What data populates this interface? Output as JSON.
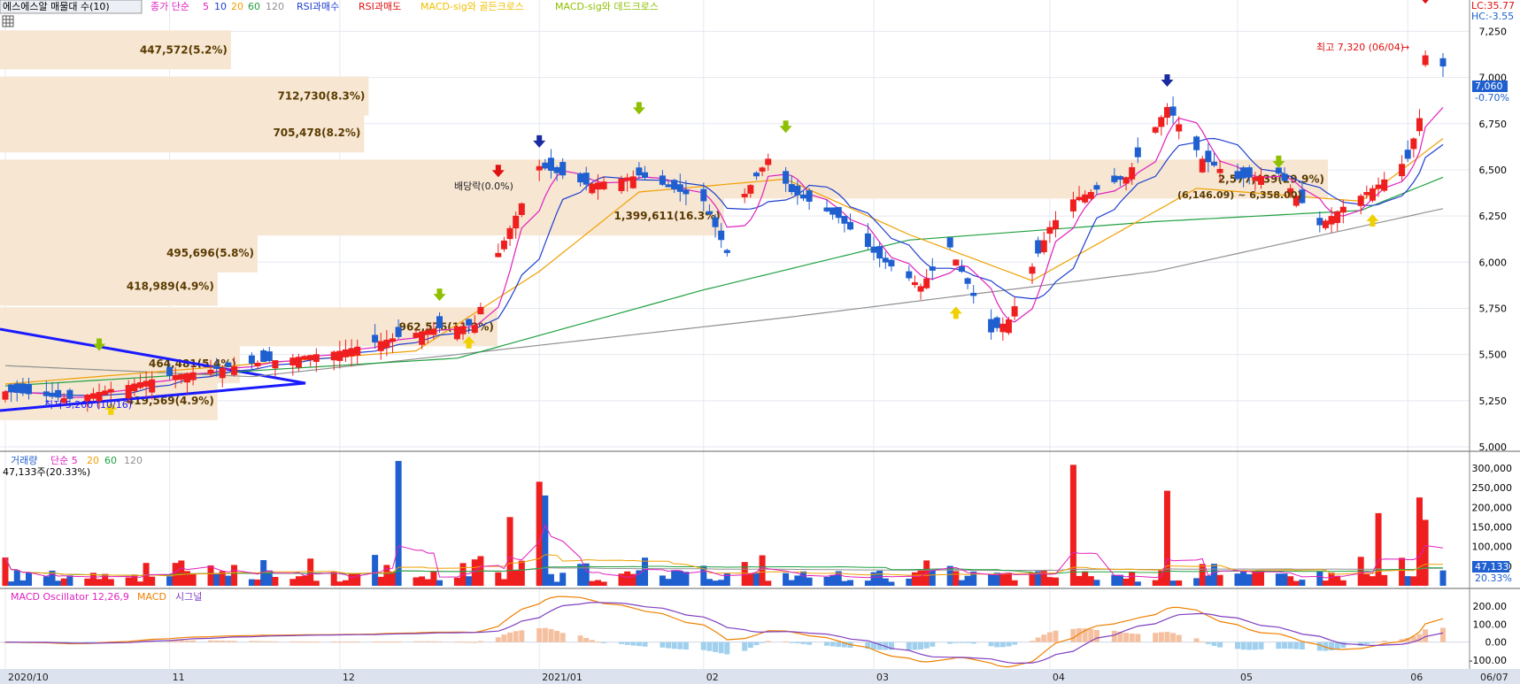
{
  "legend_main": {
    "title": "에스에스알 매물대 수(10)",
    "ma_label": "종가 단순",
    "ma_periods": [
      "5",
      "10",
      "20",
      "60",
      "120"
    ],
    "rsi_buy": "RSI과매수",
    "rsi_sell": "RSI과매도",
    "macd_golden": "MACD-sig와 골든크로스",
    "macd_dead": "MACD-sig와 데드크로스"
  },
  "corner": {
    "lc": "LC:35.77",
    "hc": "HC:-3.55"
  },
  "price_axis": {
    "ticks": [
      "7,250",
      "7,000",
      "6,750",
      "6,500",
      "6,250",
      "6,000",
      "5,750",
      "5,500",
      "5,250",
      "5,000"
    ],
    "current": "7,060",
    "current_pct": "-0.70%"
  },
  "annotations": {
    "high": "최고 7,320 (06/04)",
    "low": "최저 5,200 (10/16)",
    "dividend": "배당락(0.0%)"
  },
  "volume_profile": [
    {
      "label": "447,572(5.2%)"
    },
    {
      "label": "712,730(8.3%)"
    },
    {
      "label": "705,478(8.2%)"
    },
    {
      "label": "2,577,439(29.9%)"
    },
    {
      "label": "1,399,611(16.3%)"
    },
    {
      "label": "495,696(5.8%)"
    },
    {
      "label": "418,989(4.9%)"
    },
    {
      "label": "962,576(11.2%)"
    },
    {
      "label": "464,481(5.4%)"
    },
    {
      "label": "419,569(4.9%)"
    }
  ],
  "profile_extra": "(6,146.09) ~ 6,358.00)",
  "legend_volume": {
    "title": "거래량",
    "ma_label": "단순 5",
    "ma_periods": [
      "20",
      "60",
      "120"
    ],
    "current": "47,133주(20.33%)"
  },
  "volume_axis": {
    "ticks": [
      "300,000",
      "250,000",
      "200,000",
      "150,000",
      "100,000",
      "50,000"
    ],
    "current": "47,133",
    "current_pct": "20.33%"
  },
  "legend_macd": {
    "osc": "MACD Oscillator 12,26,9",
    "macd": "MACD",
    "signal": "시그널"
  },
  "macd_axis": {
    "ticks": [
      "200.00",
      "100.00",
      "0.00",
      "-100.00"
    ]
  },
  "date_axis": [
    "2020/10",
    "11",
    "12",
    "2021/01",
    "02",
    "03",
    "04",
    "05",
    "06",
    "06/07"
  ],
  "colors": {
    "up": "#ef1f1f",
    "down": "#1f5fcf",
    "ma5": "#e020c0",
    "ma10": "#1f3fcf",
    "ma20": "#f0a000",
    "ma60": "#20a040",
    "ma120": "#909090",
    "profile": "#f6e6d2"
  },
  "chart_data": {
    "type": "candlestick",
    "x_range": [
      "2020-10-05",
      "2021-06-07"
    ],
    "y_range": [
      5000,
      7300
    ],
    "volume_range": [
      0,
      320000
    ],
    "macd_range": [
      -130,
      250
    ],
    "price_anchors": [
      [
        "2020-10-05",
        5300
      ],
      [
        "2020-10-16",
        5260
      ],
      [
        "2020-11-01",
        5380
      ],
      [
        "2020-11-18",
        5460
      ],
      [
        "2020-12-01",
        5520
      ],
      [
        "2020-12-17",
        5640
      ],
      [
        "2020-12-24",
        5660
      ],
      [
        "2020-12-28",
        6050
      ],
      [
        "2021-01-04",
        6520
      ],
      [
        "2021-01-12",
        6420
      ],
      [
        "2021-01-21",
        6470
      ],
      [
        "2021-02-01",
        6330
      ],
      [
        "2021-02-05",
        6050
      ],
      [
        "2021-02-08",
        6370
      ],
      [
        "2021-02-12",
        6560
      ],
      [
        "2021-02-16",
        6380
      ],
      [
        "2021-02-24",
        6240
      ],
      [
        "2021-03-03",
        6020
      ],
      [
        "2021-03-10",
        5870
      ],
      [
        "2021-03-15",
        6080
      ],
      [
        "2021-03-22",
        5620
      ],
      [
        "2021-03-25",
        5690
      ],
      [
        "2021-04-01",
        6190
      ],
      [
        "2021-04-05",
        6340
      ],
      [
        "2021-04-14",
        6460
      ],
      [
        "2021-04-21",
        6840
      ],
      [
        "2021-04-27",
        6560
      ],
      [
        "2021-05-03",
        6450
      ],
      [
        "2021-05-10",
        6480
      ],
      [
        "2021-05-17",
        6200
      ],
      [
        "2021-05-21",
        6300
      ],
      [
        "2021-05-27",
        6420
      ],
      [
        "2021-06-01",
        6560
      ],
      [
        "2021-06-03",
        6780
      ],
      [
        "2021-06-04",
        7120
      ],
      [
        "2021-06-07",
        7060
      ]
    ],
    "ma_levels": {
      "ma20": [
        [
          "2020-10-05",
          5340
        ],
        [
          "2020-12-14",
          5520
        ],
        [
          "2021-01-04",
          5950
        ],
        [
          "2021-01-21",
          6380
        ],
        [
          "2021-02-15",
          6450
        ],
        [
          "2021-03-08",
          6150
        ],
        [
          "2021-03-29",
          5900
        ],
        [
          "2021-04-26",
          6400
        ],
        [
          "2021-05-24",
          6330
        ],
        [
          "2021-06-07",
          6670
        ]
      ],
      "ma60": [
        [
          "2020-10-05",
          5330
        ],
        [
          "2020-12-21",
          5480
        ],
        [
          "2021-02-01",
          5850
        ],
        [
          "2021-03-08",
          6120
        ],
        [
          "2021-04-19",
          6220
        ],
        [
          "2021-05-24",
          6280
        ],
        [
          "2021-06-07",
          6460
        ]
      ],
      "ma120": [
        [
          "2020-10-05",
          5440
        ],
        [
          "2020-11-16",
          5380
        ],
        [
          "2020-12-21",
          5500
        ],
        [
          "2021-02-15",
          5700
        ],
        [
          "2021-04-19",
          5950
        ],
        [
          "2021-06-07",
          6290
        ]
      ]
    },
    "volume_spikes": [
      [
        "2020-12-11",
        318000
      ],
      [
        "2020-12-30",
        175000
      ],
      [
        "2021-01-04",
        265000
      ],
      [
        "2021-01-05",
        230000
      ],
      [
        "2021-04-05",
        308000
      ],
      [
        "2021-04-21",
        242000
      ],
      [
        "2021-05-27",
        185000
      ],
      [
        "2021-06-03",
        225000
      ],
      [
        "2021-06-04",
        168000
      ]
    ],
    "volume_profile_bins": [
      {
        "price": 7150,
        "volume": 447572,
        "pct": 5.2
      },
      {
        "price": 6900,
        "volume": 712730,
        "pct": 8.3
      },
      {
        "price": 6700,
        "volume": 705478,
        "pct": 8.2
      },
      {
        "price": 6450,
        "volume": 2577439,
        "pct": 29.9
      },
      {
        "price": 6250,
        "volume": 1399611,
        "pct": 16.3
      },
      {
        "price": 6050,
        "volume": 495696,
        "pct": 5.8
      },
      {
        "price": 5870,
        "volume": 418989,
        "pct": 4.9
      },
      {
        "price": 5650,
        "volume": 962576,
        "pct": 11.2
      },
      {
        "price": 5450,
        "volume": 464481,
        "pct": 5.4
      },
      {
        "price": 5250,
        "volume": 419569,
        "pct": 4.9
      }
    ],
    "high": {
      "date": "2021-06-04",
      "value": 7320
    },
    "low": {
      "date": "2020-10-16",
      "value": 5200
    }
  }
}
